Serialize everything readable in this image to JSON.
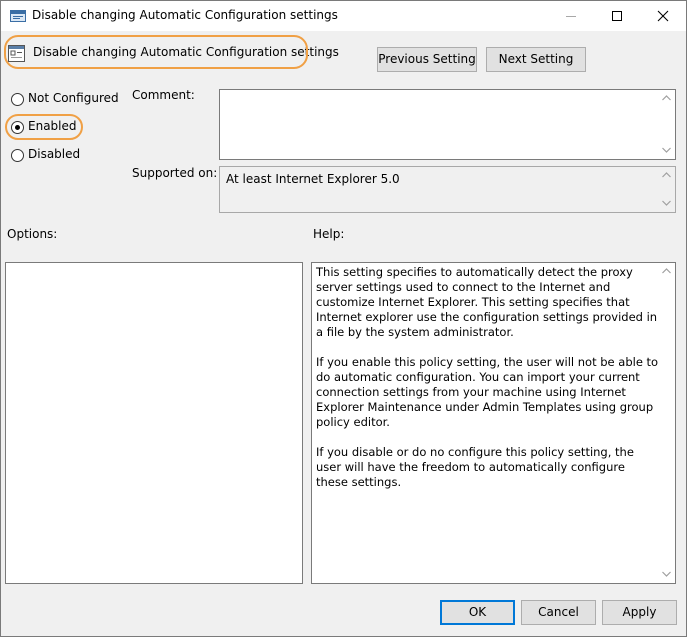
{
  "window": {
    "title": "Disable changing Automatic Configuration settings"
  },
  "header": {
    "policy_name": "Disable changing Automatic Configuration settings",
    "previous_button": "Previous Setting",
    "next_button": "Next Setting"
  },
  "state": {
    "options": [
      {
        "label": "Not Configured",
        "selected": false
      },
      {
        "label": "Enabled",
        "selected": true
      },
      {
        "label": "Disabled",
        "selected": false
      }
    ]
  },
  "comment": {
    "label": "Comment:",
    "value": ""
  },
  "supported": {
    "label": "Supported on:",
    "value": "At least Internet Explorer 5.0"
  },
  "options_panel": {
    "label": "Options:"
  },
  "help_panel": {
    "label": "Help:",
    "paragraphs": [
      "This setting specifies to automatically detect the proxy server settings used to connect to the Internet and customize Internet Explorer. This setting specifies that Internet explorer use the configuration settings provided in a file by the system administrator.",
      "If you enable this policy setting, the user will not be able to do automatic configuration. You can import your current connection settings from your machine using Internet Explorer Maintenance under Admin Templates using group policy editor.",
      "If you disable or do no configure this policy setting, the user will have the freedom to automatically configure these settings."
    ]
  },
  "footer": {
    "ok": "OK",
    "cancel": "Cancel",
    "apply": "Apply"
  },
  "colors": {
    "highlight": "#f0a045",
    "default_button_border": "#0078d7",
    "dialog_background": "#f0f0f0"
  },
  "icons": {
    "app": "policy-app-icon",
    "policy": "policy-setting-icon"
  }
}
